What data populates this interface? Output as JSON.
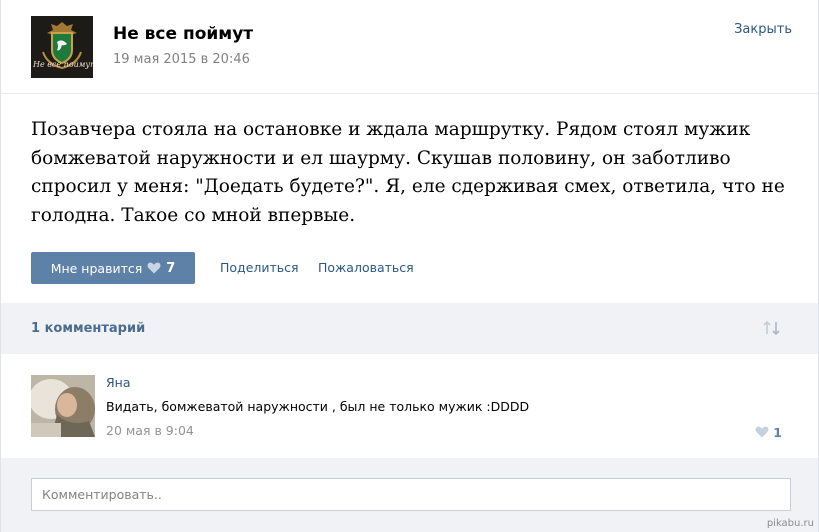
{
  "post": {
    "group_name": "Не все поймут",
    "date": "19 мая 2015 в 20:46",
    "close_label": "Закрыть",
    "avatar_logo_text": "Не все поймут",
    "avatar_logo_icon": "coat-of-arms-icon",
    "text": "Позавчера стояла на остановке и ждала маршрутку. Рядом стоял мужик бомжеватой наружности и ел шаурму. Скушав половину, он заботливо спросил у меня: \"Доедать будете?\". Я, еле сдерживая смех, ответила, что не голодна. Такое со мной впервые."
  },
  "actions": {
    "like_label": "Мне нравится",
    "like_count": "7",
    "share_label": "Поделиться",
    "report_label": "Пожаловаться"
  },
  "comments": {
    "count_label": "1 комментарий",
    "sort_icon": "sort-arrows-icon",
    "items": [
      {
        "author": "Яна",
        "text": "Видать, бомжеватой наружности , был не только мужик :DDDD",
        "date": "20 мая в 9:04",
        "likes": "1"
      }
    ]
  },
  "comment_input": {
    "placeholder": "Комментировать.."
  },
  "watermark": "pikabu.ru",
  "colors": {
    "button_blue": "#5e81a8",
    "link_blue": "#2a5885",
    "gray_text": "#828282",
    "bar_bg": "#f0f2f5"
  }
}
